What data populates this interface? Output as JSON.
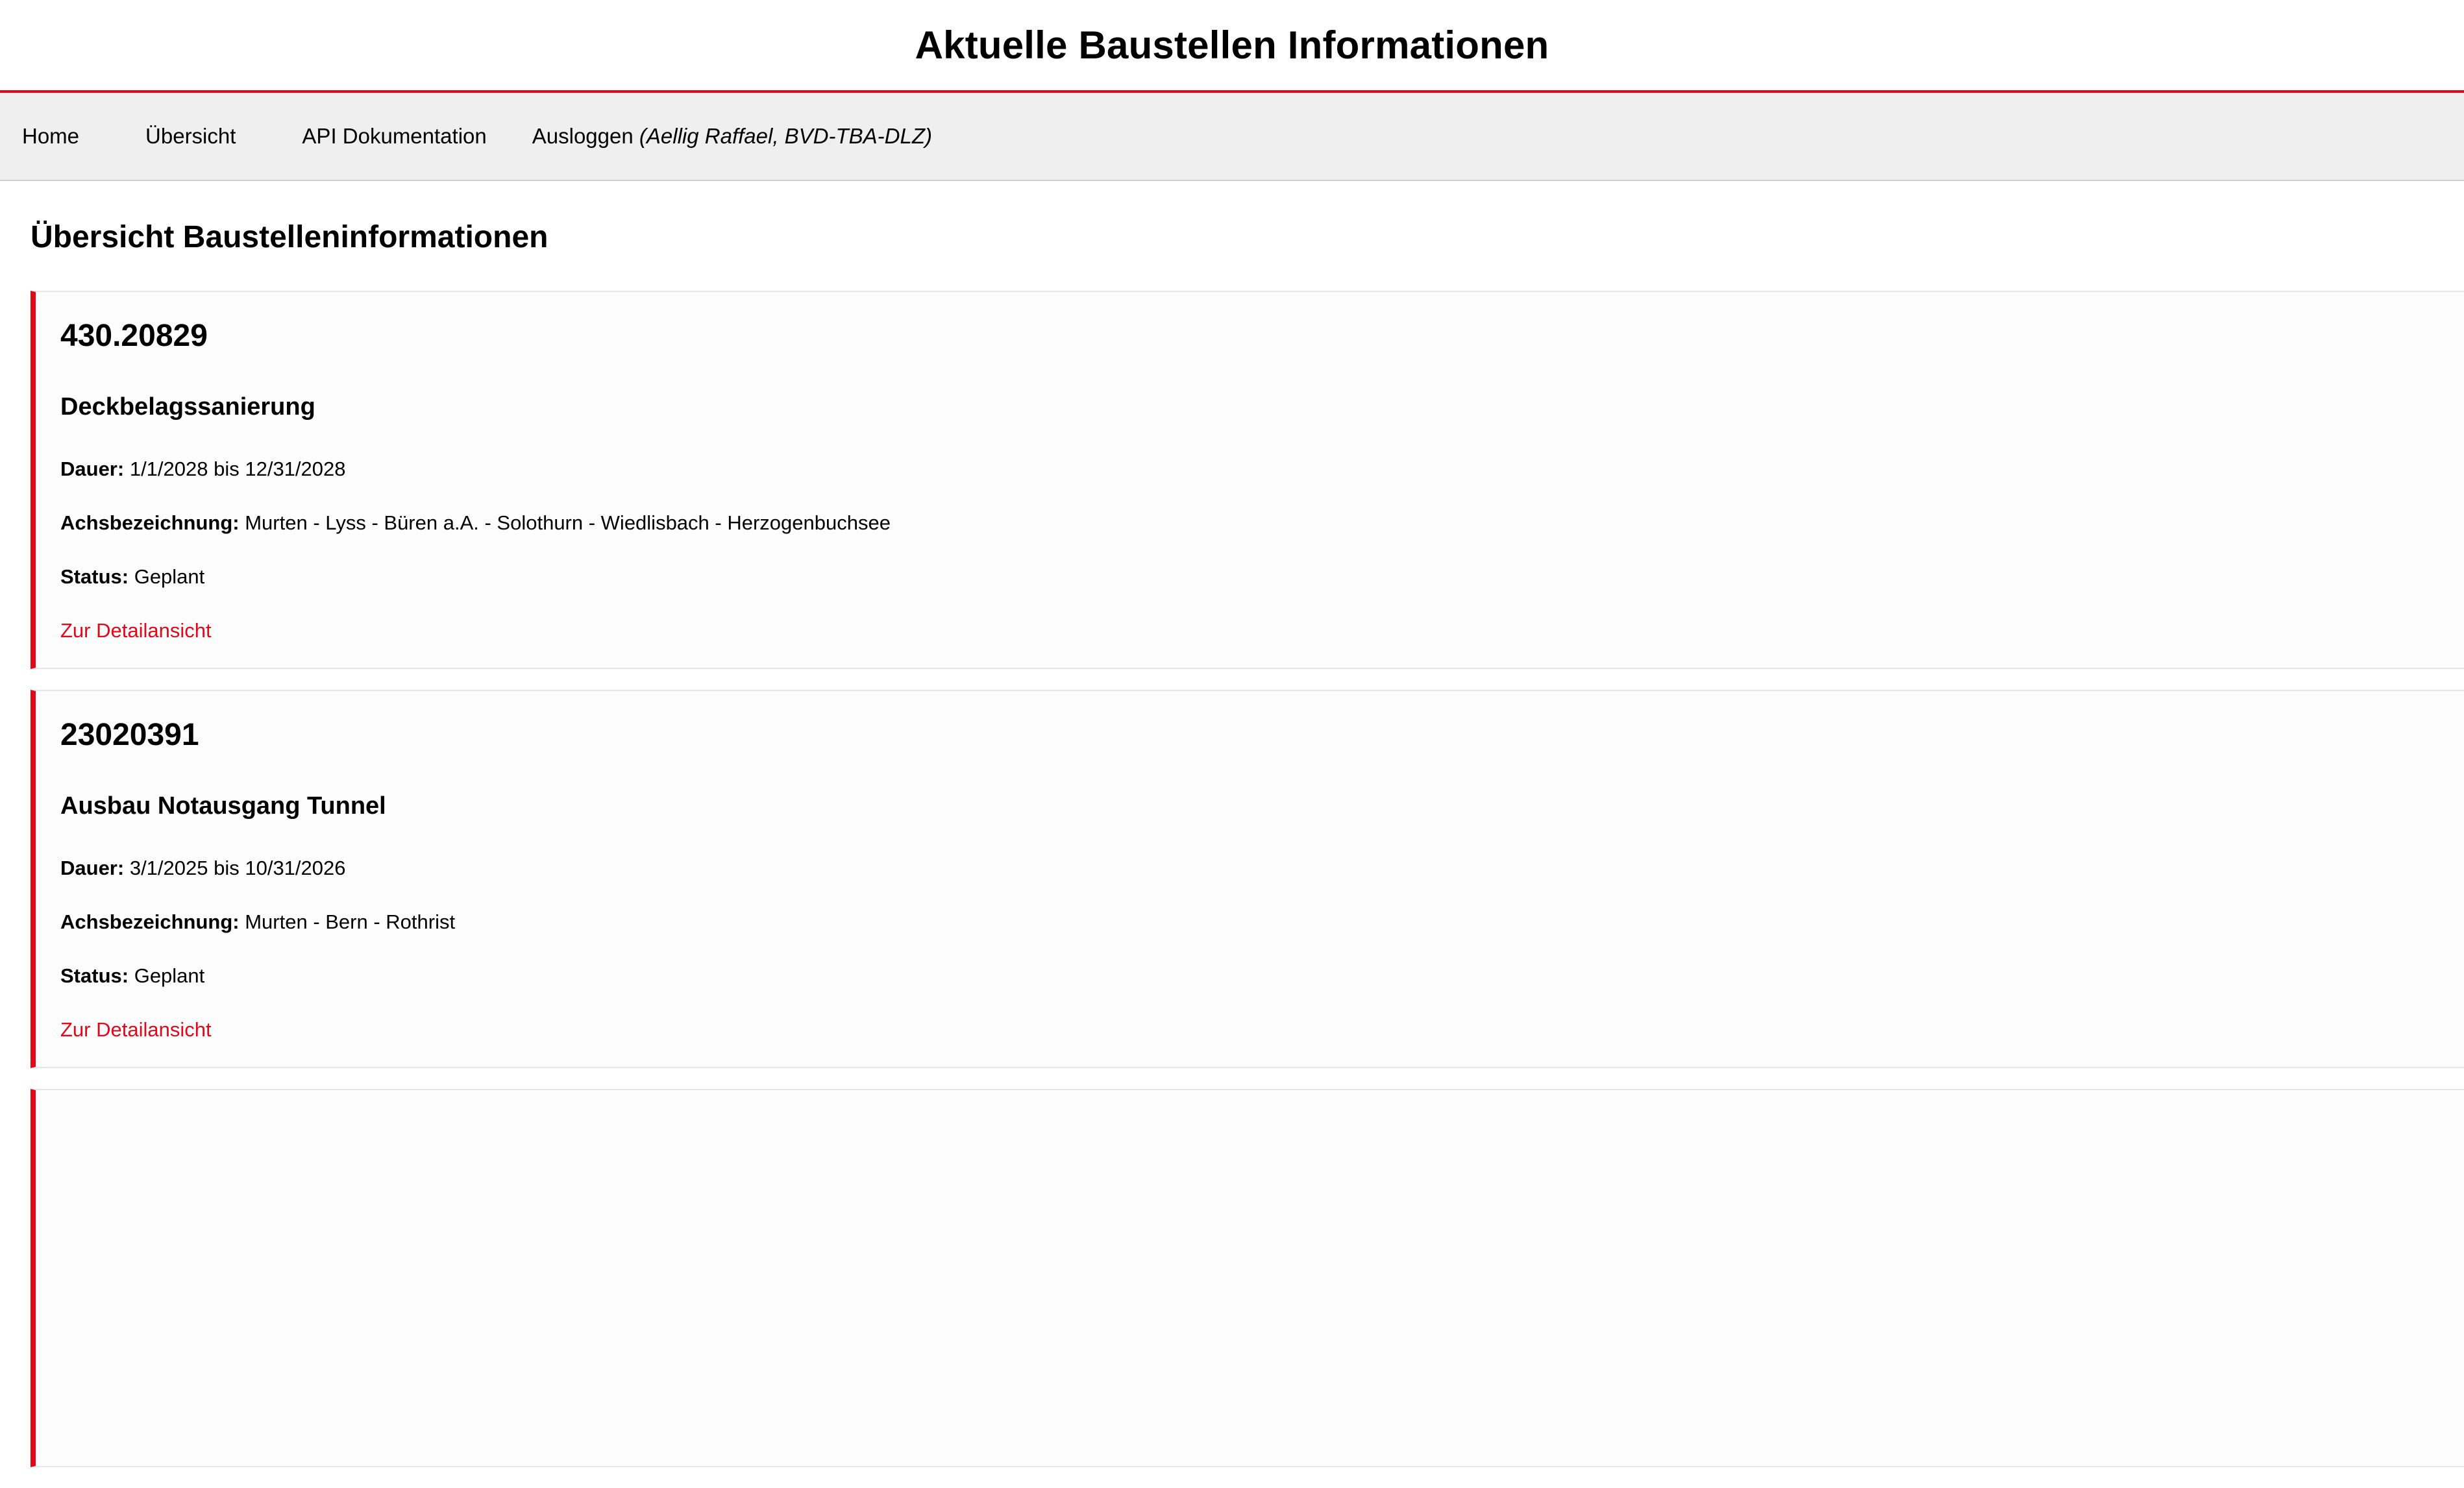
{
  "header": {
    "title": "Aktuelle Baustellen Informationen"
  },
  "nav": {
    "home": "Home",
    "overview": "Übersicht",
    "api_docs": "API Dokumentation",
    "logout": "Ausloggen",
    "user_info": "(Aellig Raffael, BVD-TBA-DLZ)"
  },
  "main": {
    "heading": "Übersicht Baustelleninformationen",
    "labels": {
      "duration": "Dauer:",
      "axis": "Achsbezeichnung:",
      "status": "Status:",
      "detail_link": "Zur Detailansicht"
    },
    "items": [
      {
        "number": "430.20829",
        "name": "Deckbelagssanierung",
        "duration": "1/1/2028 bis 12/31/2028",
        "axis": "Murten - Lyss - Büren a.A. - Solothurn - Wiedlisbach - Herzogenbuchsee",
        "status": "Geplant"
      },
      {
        "number": "23020391",
        "name": "Ausbau Notausgang Tunnel",
        "duration": "3/1/2025 bis 10/31/2026",
        "axis": "Murten - Bern - Rothrist",
        "status": "Geplant"
      }
    ]
  },
  "colors": {
    "accent": "#e1081a",
    "nav_background": "#efefef",
    "card_background": "#fcfcfc"
  }
}
